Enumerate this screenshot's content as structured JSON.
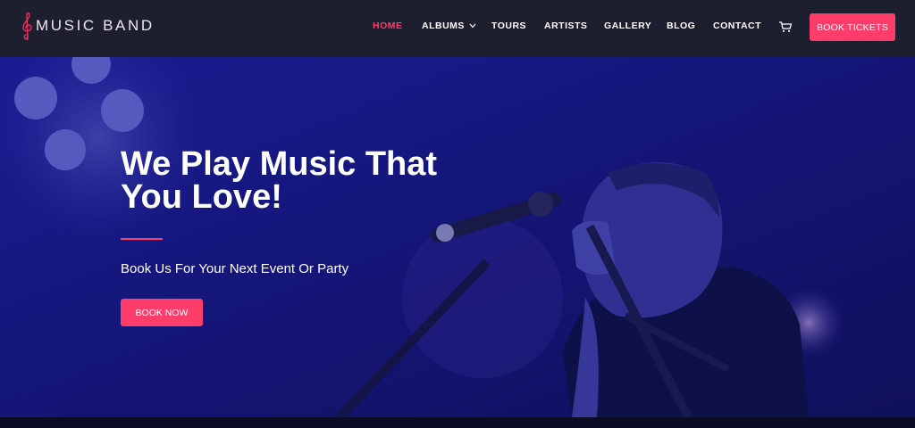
{
  "header": {
    "logo_text": "MUSIC BAND",
    "logo_icon": "treble-clef-icon",
    "nav": [
      {
        "label": "HOME",
        "active": true
      },
      {
        "label": "ALBUMS",
        "has_dropdown": true
      },
      {
        "label": "TOURS"
      },
      {
        "label": "ARTISTS"
      },
      {
        "label": "GALLERY"
      },
      {
        "label": "BLOG"
      },
      {
        "label": "CONTACT"
      }
    ],
    "cart_icon": "cart-icon",
    "cta_label": "BOOK TICKETS"
  },
  "hero": {
    "title": "We Play Music That You Love!",
    "subtitle": "Book Us For Your Next Event Or Party",
    "cta_label": "BOOK NOW",
    "background": "singer-with-microphone-photo"
  },
  "colors": {
    "accent": "#ff3d6a",
    "header_bg": "#1e1f2e",
    "hero_overlay": "#13156a"
  }
}
